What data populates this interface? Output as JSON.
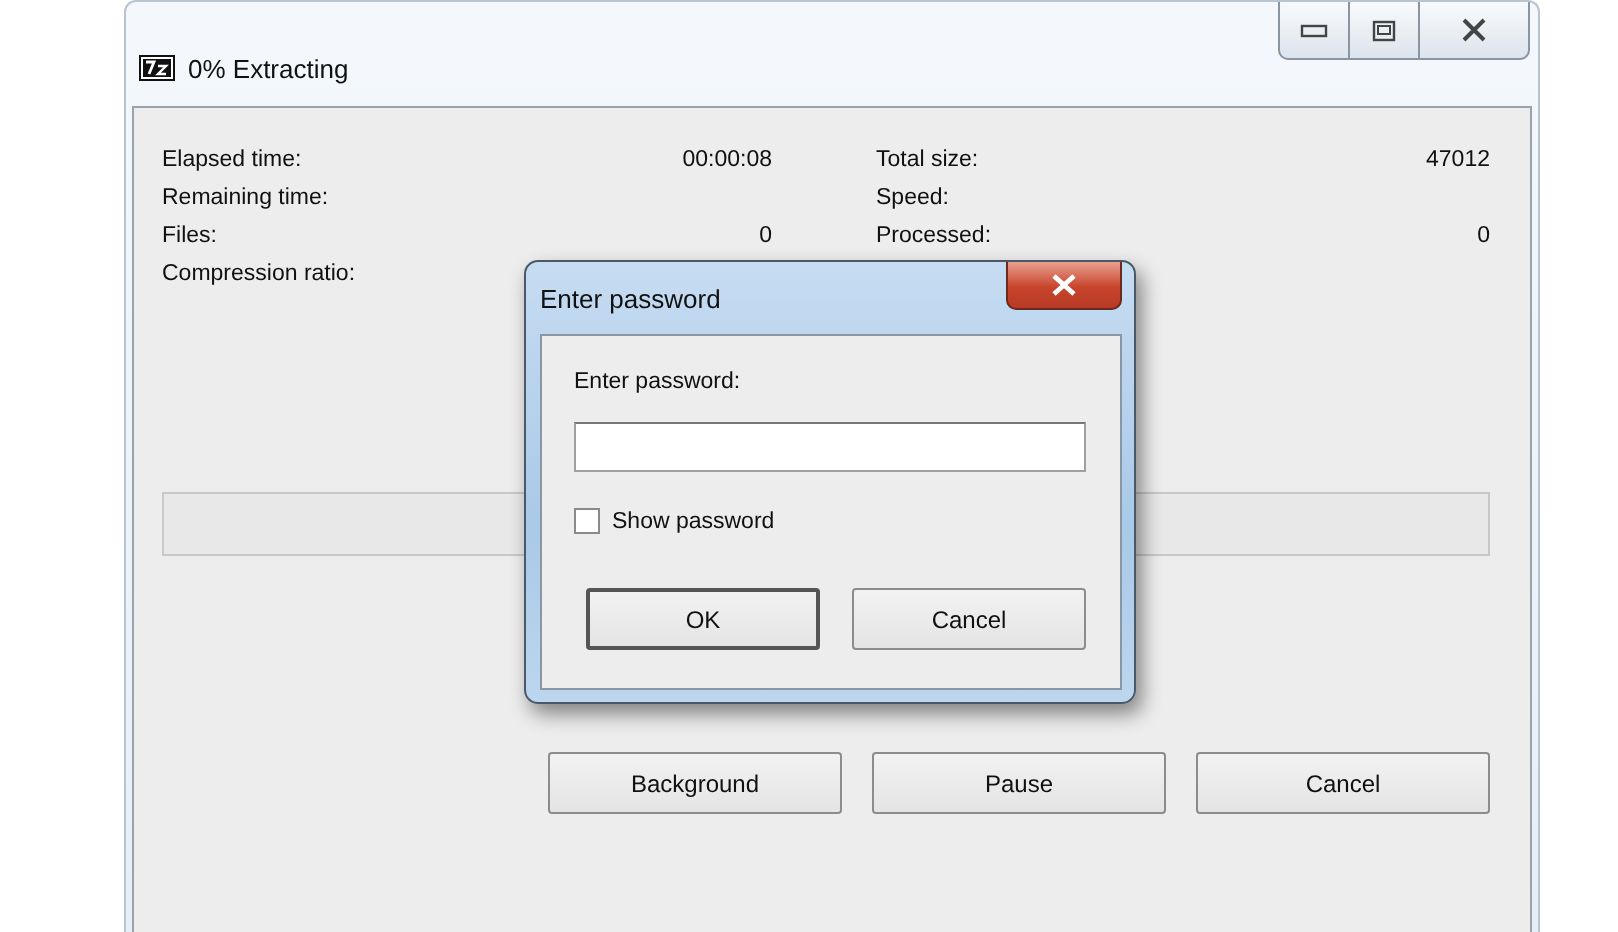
{
  "window": {
    "title": "0% Extracting"
  },
  "stats_left": [
    {
      "label": "Elapsed time:",
      "value": "00:00:08"
    },
    {
      "label": "Remaining time:"
    },
    {
      "label": "Files:",
      "value": "0"
    },
    {
      "label": "Compression ratio:"
    }
  ],
  "stats_right": [
    {
      "label": "Total size:",
      "value": "47012"
    },
    {
      "label": "Speed:"
    },
    {
      "label": "Processed:",
      "value": "0"
    }
  ],
  "progress": {
    "level": 0
  },
  "buttons": [
    "Background",
    "Pause",
    "Cancel"
  ],
  "dialog": {
    "title": "Enter password",
    "prompt": "Enter password:",
    "show_password": {
      "label": "Show password",
      "checked": false
    },
    "buttons": [
      "OK",
      "Cancel"
    ]
  }
}
